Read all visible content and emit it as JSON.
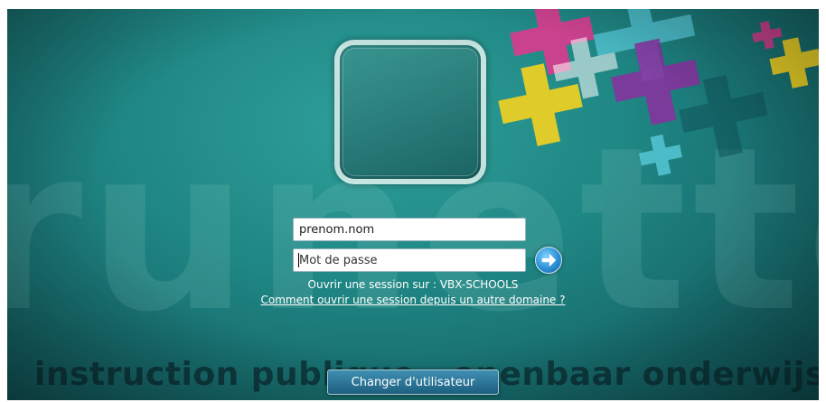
{
  "login": {
    "username_value": "prenom.nom",
    "password_placeholder": "Mot de passe",
    "session_text": "Ouvrir une session sur : VBX-SCHOOLS",
    "domain_link": "Comment ouvrir une session depuis un autre domaine ?",
    "submit_icon": "arrow-right-icon"
  },
  "background": {
    "watermark": "runette",
    "tagline": "instruction publique - openbaar onderwijs"
  },
  "footer": {
    "switch_user_label": "Changer d'utilisateur"
  },
  "colors": {
    "background": "#1f8784",
    "cross_colors": [
      "#f4d21f",
      "#e8368f",
      "#8b2fa0",
      "#56c7d6",
      "#ffffff"
    ]
  }
}
